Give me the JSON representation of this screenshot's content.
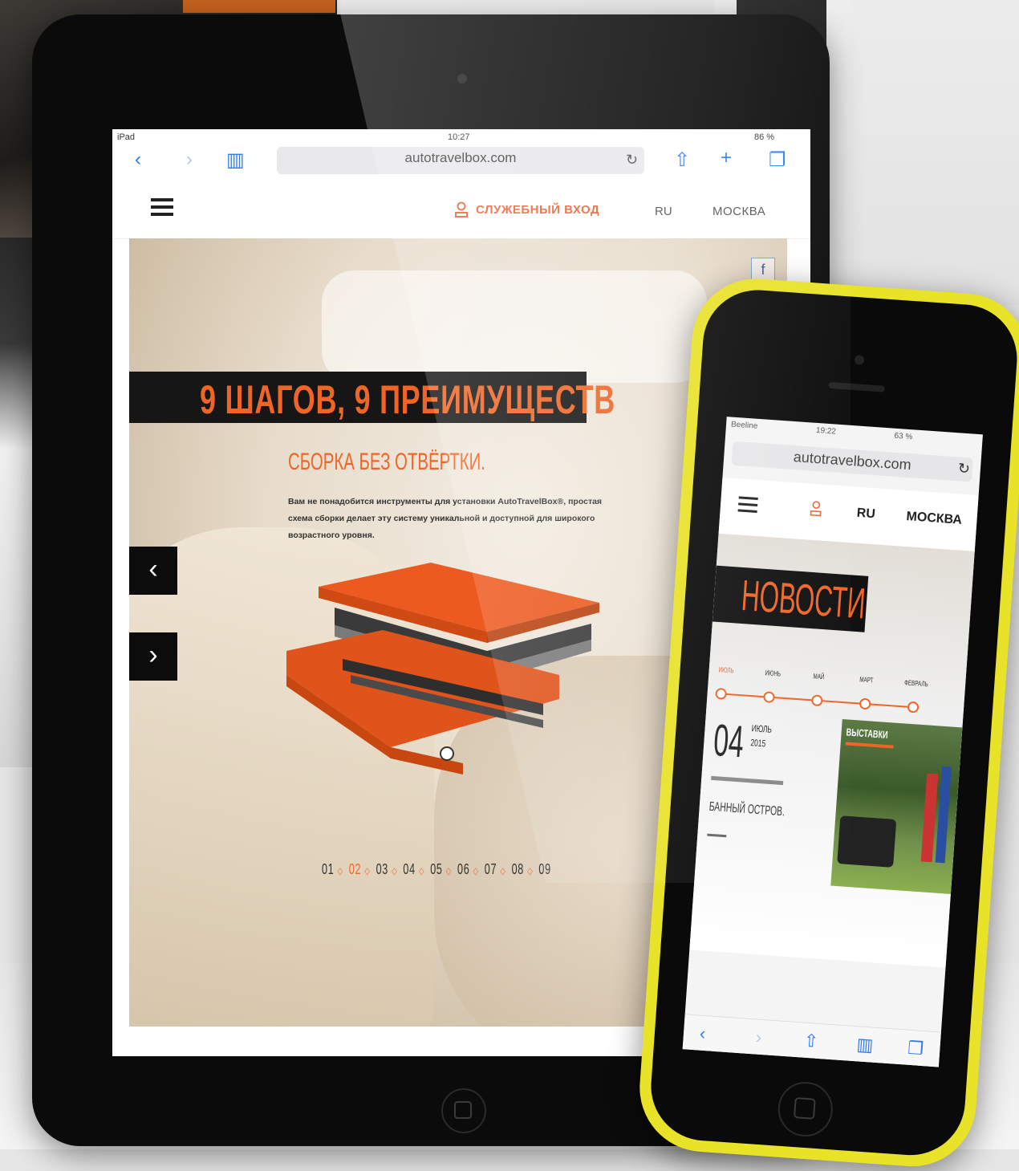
{
  "ipad": {
    "status": {
      "carrier": "iPad",
      "time": "10:27",
      "battery": "86 %"
    },
    "browser": {
      "url": "autotravelbox.com"
    },
    "nav": {
      "login": "СЛУЖЕБНЫЙ ВХОД",
      "language": "RU",
      "city": "МОСКВА"
    },
    "share": {
      "facebook": "f"
    },
    "hero": {
      "title": "9 ШАГОВ, 9 ПРЕИМУЩЕСТВ",
      "step_title": "СБОРКА БЕЗ ОТВЁРТКИ.",
      "step_description": "Вам не понадобится инструменты для установки AutoTravelBox®, простая схема сборки делает эту систему уникальной и доступной для широкого возрастного уровня.",
      "prev_label": "‹",
      "next_label": "›"
    },
    "steps": [
      "01",
      "02",
      "03",
      "04",
      "05",
      "06",
      "07",
      "08",
      "09"
    ],
    "active_step": "02"
  },
  "iphone": {
    "status": {
      "carrier": "Beeline",
      "time": "19:22",
      "battery": "63 %"
    },
    "browser": {
      "url": "autotravelbox.com"
    },
    "nav": {
      "language": "RU",
      "city": "МОСКВА"
    },
    "news": {
      "title": "НОВОСТИ",
      "timeline": [
        "ИЮЛЬ",
        "ИЮНЬ",
        "МАЙ",
        "МАРТ",
        "ФЕВРАЛЬ"
      ],
      "date_day": "04",
      "date_month": "ИЮЛЬ",
      "date_year": "2015",
      "headline": "БАННЫЙ ОСТРОВ.",
      "card_label": "ВЫСТАВКИ"
    }
  },
  "colors": {
    "accent": "#ef6526",
    "phone_body": "#e8e228",
    "safari_blue": "#2f7cf6"
  }
}
